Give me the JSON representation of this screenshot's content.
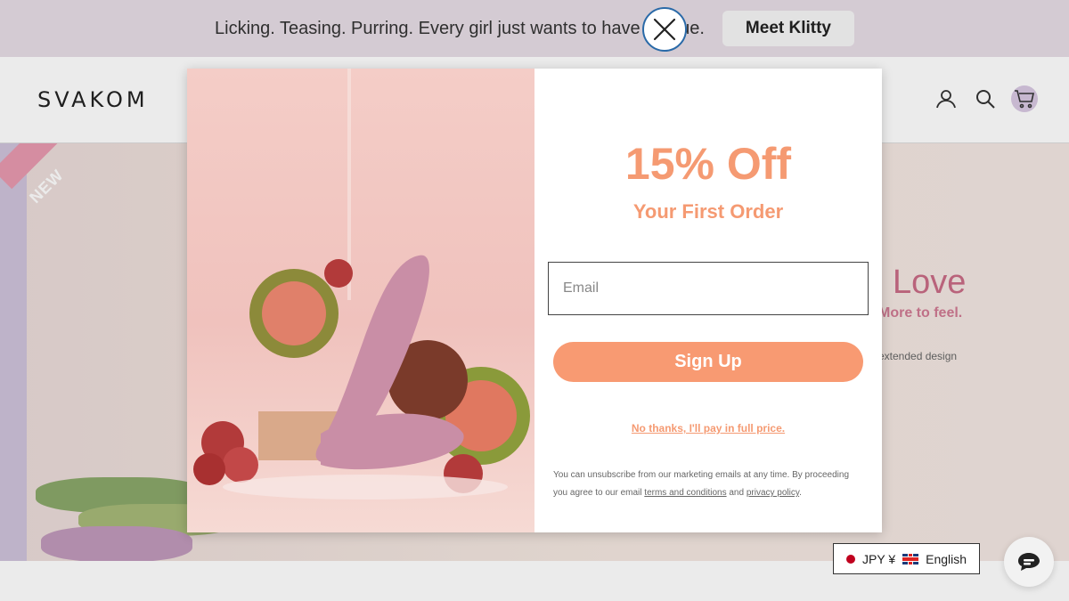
{
  "announcement": {
    "message": "Licking. Teasing. Purring. Every girl just wants to have tongue.",
    "cta_label": "Meet Klitty"
  },
  "header": {
    "logo": "SVAKOM",
    "icons": [
      "account-icon",
      "search-icon",
      "cart-icon"
    ]
  },
  "hero": {
    "badge": "NEW",
    "title": "Love",
    "subtitle": "More to feel.",
    "description": "extended design"
  },
  "popup": {
    "offer": "15% Off",
    "offer_sub": "Your First Order",
    "email_placeholder": "Email",
    "signup_label": "Sign Up",
    "decline_label": "No thanks, I'll pay in full price.",
    "legal_before": "You can unsubscribe from our marketing emails at any time. By proceeding you agree to our email",
    "terms_link": "terms and conditions",
    "legal_and": "and",
    "privacy_link": "privacy policy",
    "legal_end": ".",
    "close_icon": "close-icon",
    "accent_color": "#f59a72"
  },
  "locale": {
    "currency": "JPY ¥",
    "language": "English"
  }
}
